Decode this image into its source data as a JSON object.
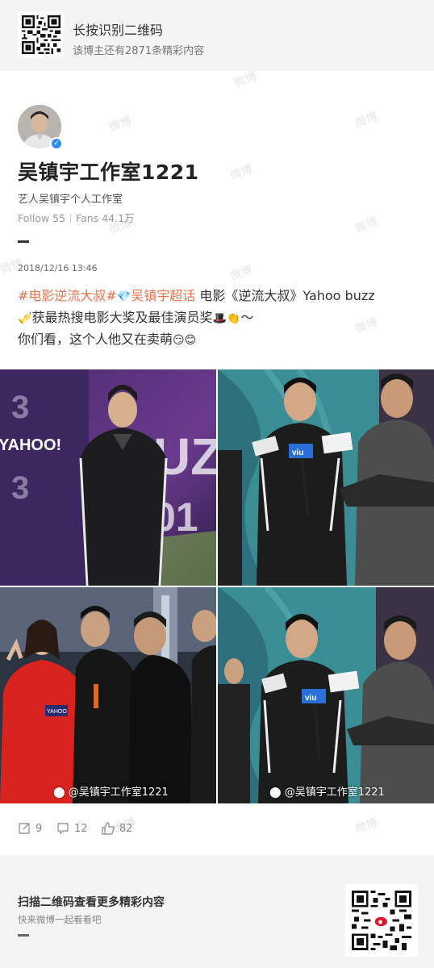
{
  "banner": {
    "title": "长按识别二维码",
    "subtitle": "该博主还有2871条精彩内容"
  },
  "profile": {
    "name": "吴镇宇工作室1221",
    "description": "艺人吴镇宇个人工作室",
    "follow": "Follow 55",
    "fans": "Fans 44.1万"
  },
  "post": {
    "time": "2018/12/16 13:46",
    "tag1": "#电影逆流大叔#",
    "tag2": "吴镇宇超话",
    "line1_rest": " 电影《逆流大叔》Yahoo buzz",
    "line2": "获最热搜电影大奖及最佳演员奖",
    "line2_end": "～",
    "line3": "你们看，这个人他又在卖萌",
    "emoji_supertopic": "💎",
    "emoji_trophy": "🎺",
    "emoji_hat": "🎩",
    "emoji_clap": "👏",
    "emoji_smile1": "😏",
    "emoji_smile2": "😊"
  },
  "photos": {
    "watermark": "@吴镇宇工作室1221"
  },
  "actions": {
    "reposts": "9",
    "comments": "12",
    "likes": "82"
  },
  "bottom": {
    "title": "扫描二维码查看更多精彩内容",
    "subtitle": "快来微博一起看看吧"
  },
  "colors": {
    "tag": "#eb7350",
    "verify": "#2e8cf0",
    "background": "#f4f4f4"
  },
  "icons": [
    "qr-code-icon",
    "verified-icon",
    "repost-icon",
    "comment-icon",
    "like-icon",
    "weibo-logo-icon"
  ]
}
